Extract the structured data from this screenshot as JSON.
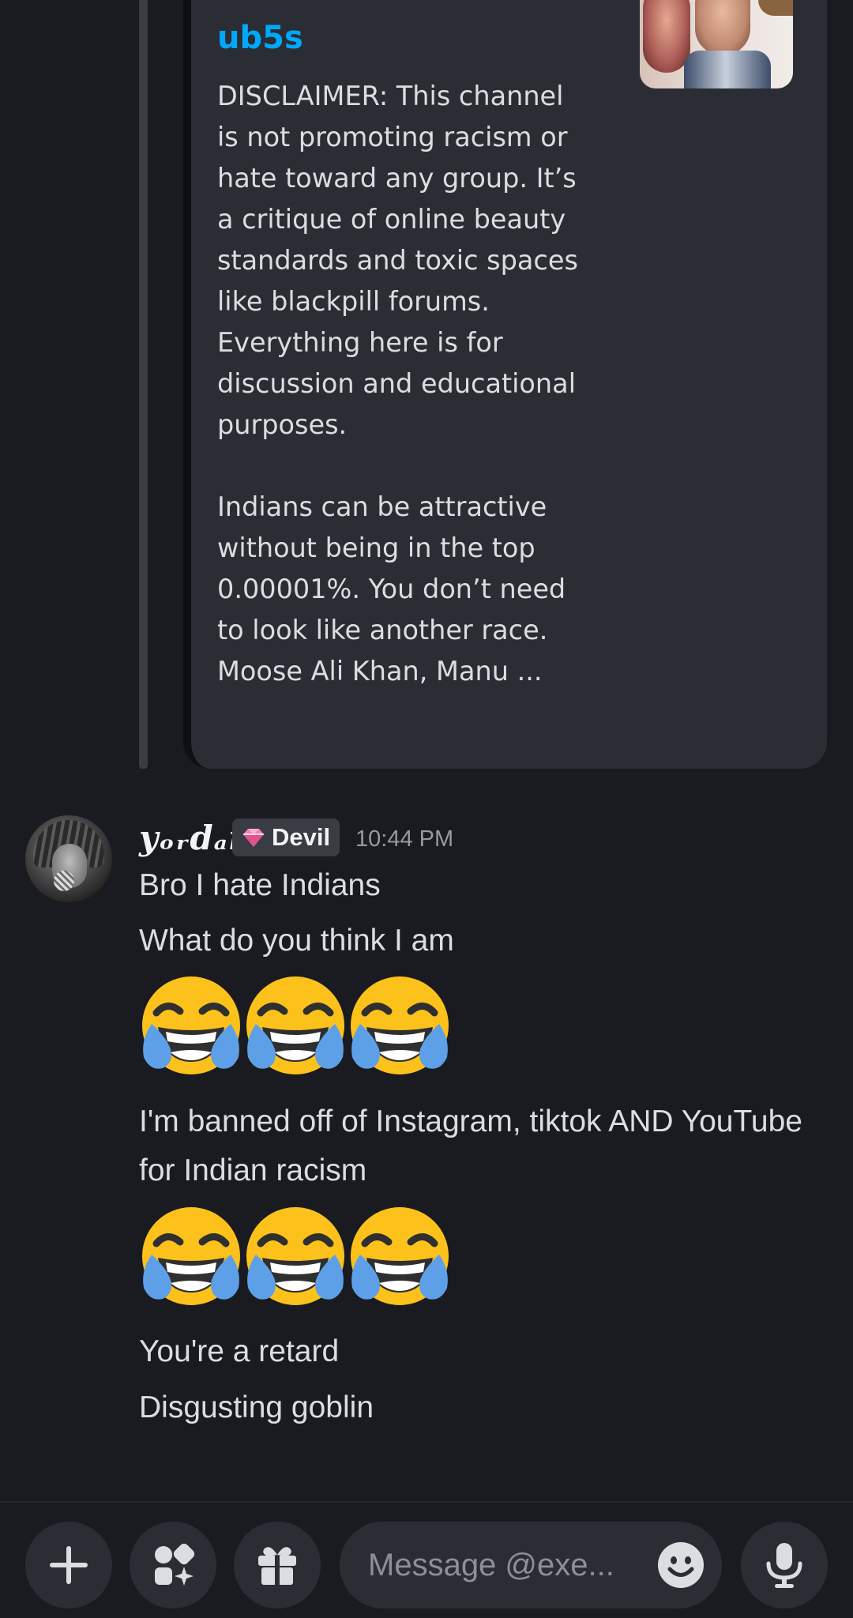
{
  "embed": {
    "link_partial": "ub5s",
    "description": "DISCLAIMER: This channel is not promoting racism or hate toward any group. It’s a critique of online beauty standards and toxic spaces like blackpill forums. Everything here is for discussion and educational purposes.\n\nIndians can be attractive without being in the top 0.00001%. You don’t need to look like another race. Moose Ali Khan, Manu ..."
  },
  "message": {
    "username": "yₒᵣdₐn",
    "badge_label": "Devil",
    "timestamp": "10:44 PM",
    "lines": {
      "l1": "Bro I hate Indians",
      "l2": "What do you think I am",
      "l3": "I'm banned off of Instagram, tiktok AND YouTube for Indian racism",
      "l4": "You're a retard",
      "l5": "Disgusting goblin"
    },
    "emoji": "face-with-tears-of-joy"
  },
  "composer": {
    "placeholder": "Message @exe...",
    "icons": [
      "plus-icon",
      "apps-icon",
      "gift-icon",
      "emoji-icon",
      "microphone-icon"
    ]
  },
  "colors": {
    "background": "#1a1b20",
    "embed_bg": "#2b2d34",
    "link": "#00a8fc",
    "text": "#dbdee1",
    "muted": "#949ba4"
  }
}
